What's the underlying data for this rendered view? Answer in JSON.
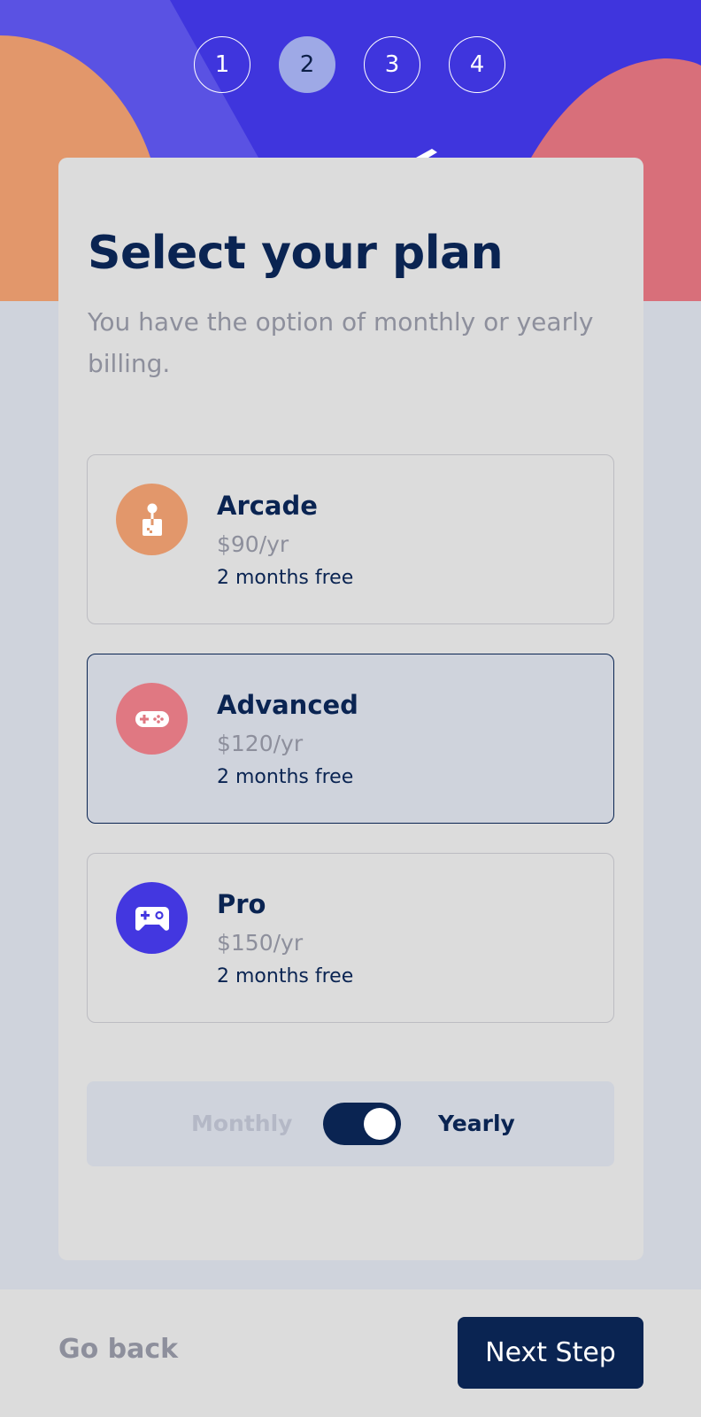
{
  "colors": {
    "hero_blue": "#3f35dd",
    "hero_orange": "#e2976b",
    "hero_pink": "#d86f7a",
    "marine_blue": "#0a2452",
    "card_bg": "#dcdcdc",
    "page_bg": "#cfd3dc"
  },
  "steps": {
    "items": [
      "1",
      "2",
      "3",
      "4"
    ],
    "active": "2"
  },
  "card": {
    "title": "Select your plan",
    "subtitle": "You have the option of monthly or yearly billing."
  },
  "plans": [
    {
      "name": "Arcade",
      "price": "$90/yr",
      "promo": "2 months free",
      "icon": "arcade-joystick-icon",
      "icon_color": "#e2976b",
      "selected": false
    },
    {
      "name": "Advanced",
      "price": "$120/yr",
      "promo": "2 months free",
      "icon": "advanced-gamepad-icon",
      "icon_color": "#e07882",
      "selected": true
    },
    {
      "name": "Pro",
      "price": "$150/yr",
      "promo": "2 months free",
      "icon": "pro-controller-icon",
      "icon_color": "#4337e0",
      "selected": false
    }
  ],
  "billing": {
    "monthly_label": "Monthly",
    "yearly_label": "Yearly",
    "selected": "Yearly"
  },
  "footer": {
    "back_label": "Go back",
    "next_label": "Next Step"
  }
}
